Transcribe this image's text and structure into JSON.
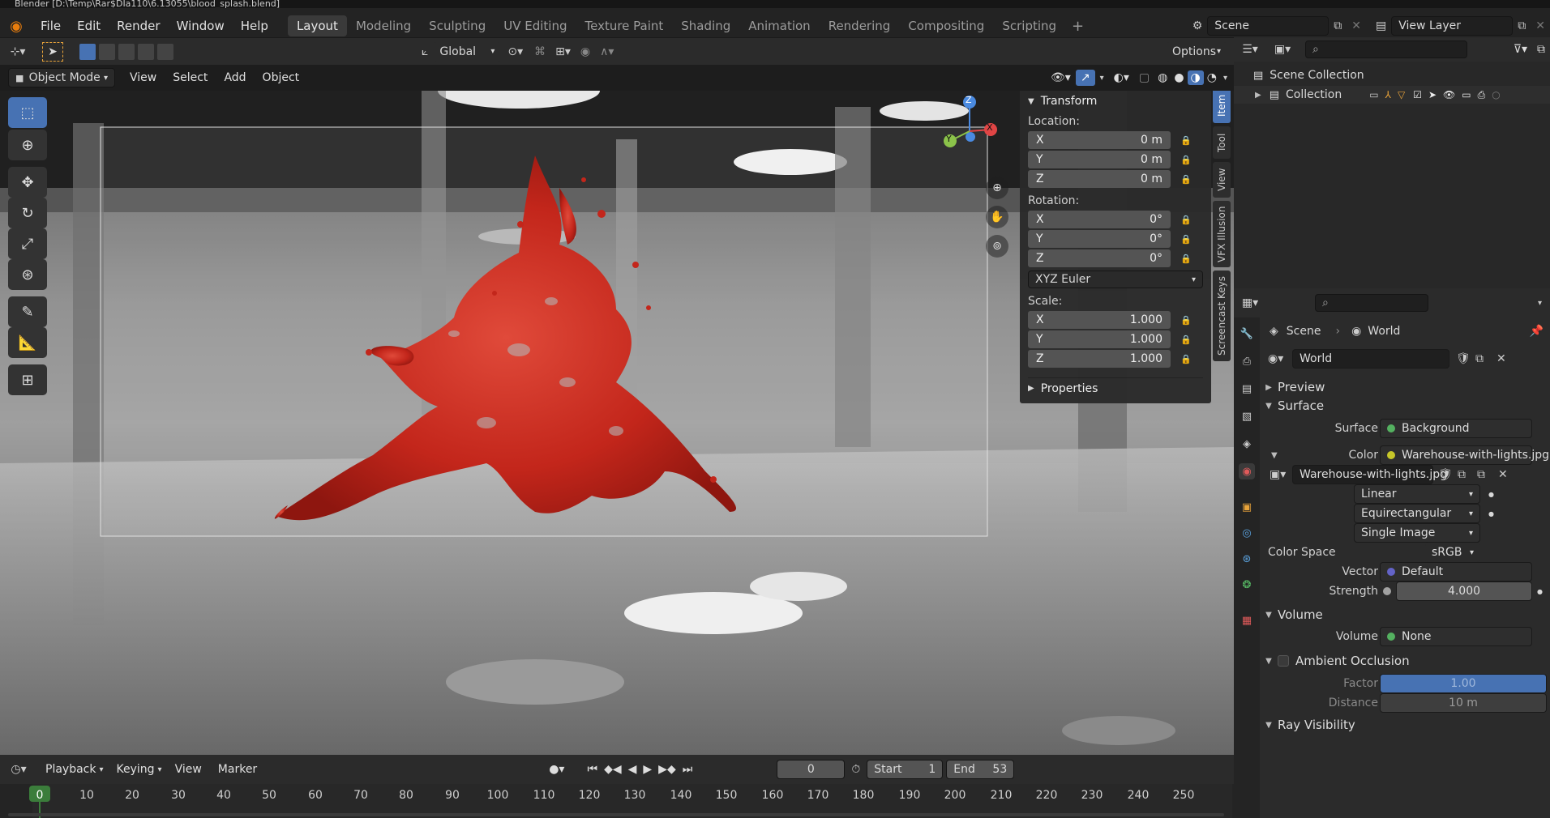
{
  "window": {
    "title": "Blender [D:\\Temp\\Rar$DIa110\\6.13055\\blood_splash.blend]"
  },
  "menu": {
    "items": [
      "File",
      "Edit",
      "Render",
      "Window",
      "Help"
    ]
  },
  "workspaces": [
    "Layout",
    "Modeling",
    "Sculpting",
    "UV Editing",
    "Texture Paint",
    "Shading",
    "Animation",
    "Rendering",
    "Compositing",
    "Scripting"
  ],
  "active_workspace": "Layout",
  "scene_selector": {
    "value": "Scene"
  },
  "view_layer_selector": {
    "value": "View Layer"
  },
  "tool_header": {
    "orientation": "Global",
    "options": "Options"
  },
  "viewport_header": {
    "mode": "Object Mode",
    "menus": [
      "View",
      "Select",
      "Add",
      "Object"
    ]
  },
  "npanel": {
    "transform_title": "Transform",
    "location_label": "Location:",
    "location": [
      {
        "axis": "X",
        "value": "0 m"
      },
      {
        "axis": "Y",
        "value": "0 m"
      },
      {
        "axis": "Z",
        "value": "0 m"
      }
    ],
    "rotation_label": "Rotation:",
    "rotation": [
      {
        "axis": "X",
        "value": "0°"
      },
      {
        "axis": "Y",
        "value": "0°"
      },
      {
        "axis": "Z",
        "value": "0°"
      }
    ],
    "rotation_mode": "XYZ Euler",
    "scale_label": "Scale:",
    "scale": [
      {
        "axis": "X",
        "value": "1.000"
      },
      {
        "axis": "Y",
        "value": "1.000"
      },
      {
        "axis": "Z",
        "value": "1.000"
      }
    ],
    "properties_title": "Properties"
  },
  "npanel_tabs": [
    "Item",
    "Tool",
    "View",
    "VFX Illusion",
    "Screencast Keys"
  ],
  "gizmo": {
    "x": "X",
    "y": "Y",
    "z": "Z"
  },
  "timeline_header": {
    "menus": [
      "Playback",
      "Keying",
      "View",
      "Marker"
    ],
    "current_frame": "0",
    "start_label": "Start",
    "start": "1",
    "end_label": "End",
    "end": "53"
  },
  "timeline": {
    "ticks": [
      "0",
      "10",
      "20",
      "30",
      "40",
      "50",
      "60",
      "70",
      "80",
      "90",
      "100",
      "110",
      "120",
      "130",
      "140",
      "150",
      "160",
      "170",
      "180",
      "190",
      "200",
      "210",
      "220",
      "230",
      "240",
      "250"
    ],
    "current": "0"
  },
  "outliner": {
    "scene_collection": "Scene Collection",
    "collection": "Collection"
  },
  "properties": {
    "breadcrumb_scene": "Scene",
    "breadcrumb_world": "World",
    "world_name": "World",
    "sections": {
      "preview": "Preview",
      "surface": "Surface",
      "volume": "Volume",
      "ambient_occlusion": "Ambient Occlusion",
      "ray_visibility": "Ray Visibility"
    },
    "surface_label": "Surface",
    "surface_value": "Background",
    "color_label": "Color",
    "color_value": "Warehouse-with-lights.jpg",
    "image_name": "Warehouse-with-lights.jpg",
    "interpolation": "Linear",
    "projection": "Equirectangular",
    "source": "Single Image",
    "color_space_label": "Color Space",
    "color_space": "sRGB",
    "vector_label": "Vector",
    "vector_value": "Default",
    "strength_label": "Strength",
    "strength": "4.000",
    "volume_label": "Volume",
    "volume_value": "None",
    "ao_factor_label": "Factor",
    "ao_factor": "1.00",
    "ao_distance_label": "Distance",
    "ao_distance": "10 m"
  },
  "colors": {
    "accent": "#4772b3",
    "splash": "#c8281e",
    "socket_green": "#54b160",
    "socket_yellow": "#c7c729",
    "socket_purple": "#6363c7"
  }
}
